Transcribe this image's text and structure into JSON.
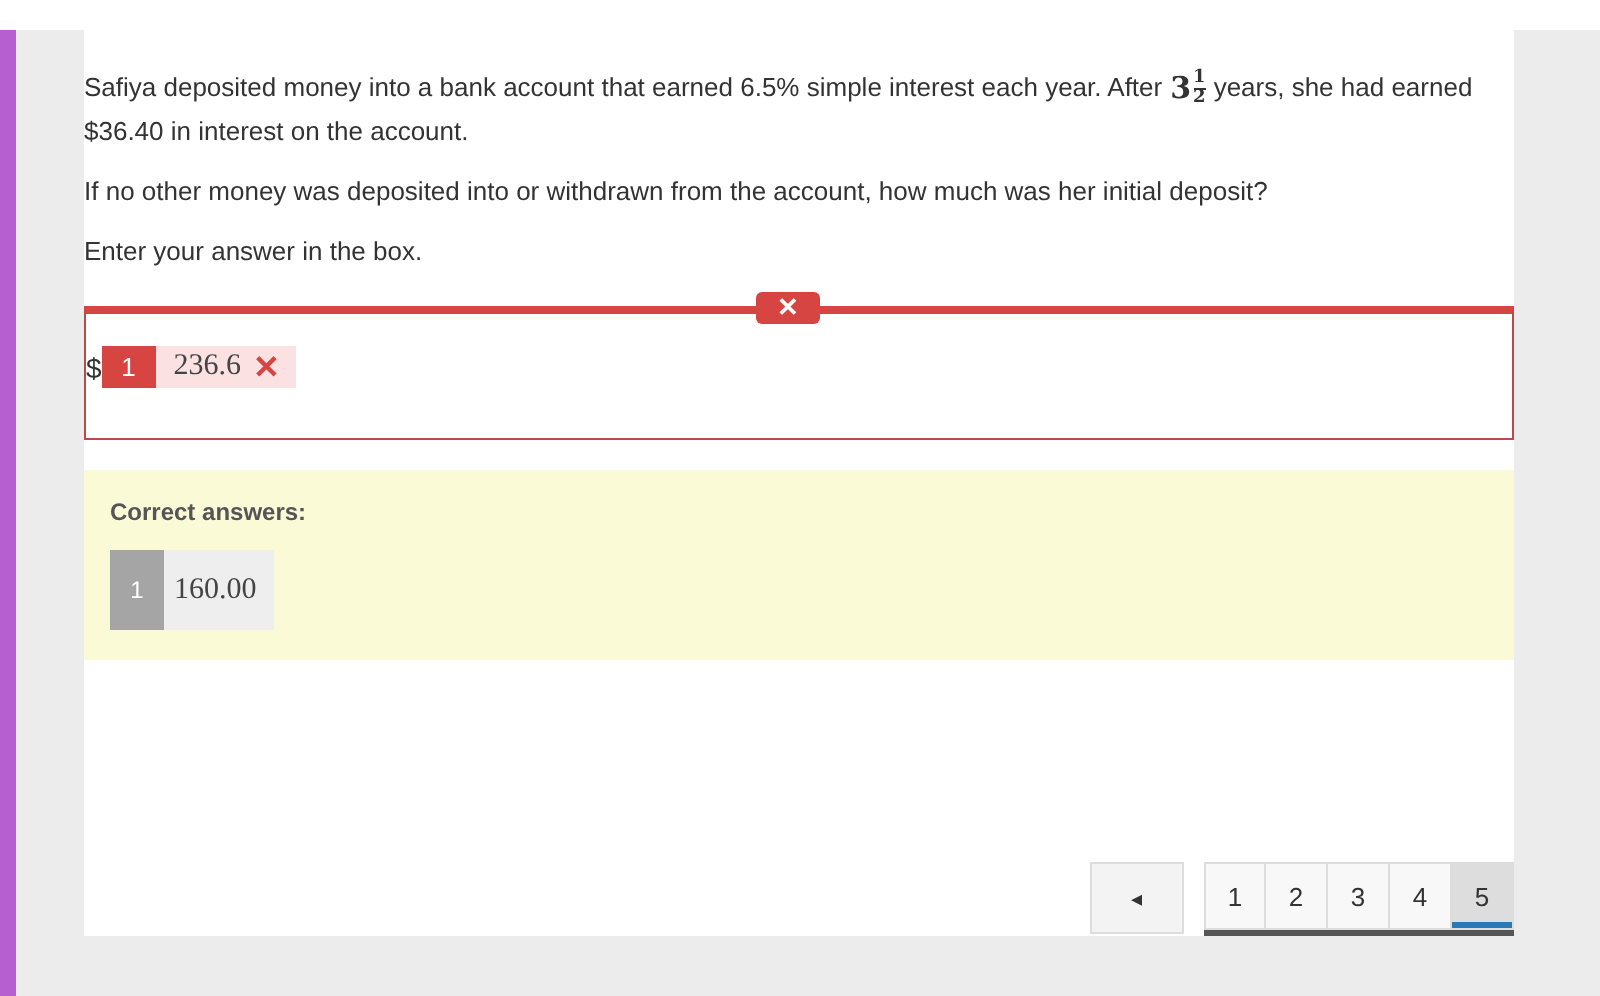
{
  "question": {
    "before": "Safiya deposited money into a bank account that earned 6.5% simple interest each year. After",
    "mixed_number": {
      "whole": "3",
      "numerator": "1",
      "denominator": "2"
    },
    "after": "years, she had earned $36.40 in interest on the account.",
    "paragraphs": [
      "If no other money was deposited into or withdrawn from the account, how much was her initial deposit?",
      "Enter your answer in the box."
    ]
  },
  "response": {
    "correct": false,
    "status_mark": "✕",
    "prefix": "$",
    "answers": [
      {
        "index": "1",
        "value": "236.6",
        "mark": "✕"
      }
    ]
  },
  "correct_answers": {
    "title": "Correct answers:",
    "answers": [
      {
        "index": "1",
        "value": "160.00"
      }
    ]
  },
  "pagination": {
    "prev": "◂",
    "pages": [
      {
        "label": "1",
        "selected": false
      },
      {
        "label": "2",
        "selected": false
      },
      {
        "label": "3",
        "selected": false
      },
      {
        "label": "4",
        "selected": false
      },
      {
        "label": "5",
        "selected": true
      }
    ]
  }
}
